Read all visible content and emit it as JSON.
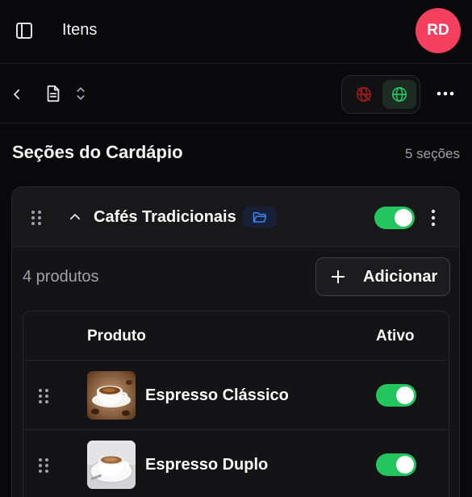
{
  "header": {
    "title": "Itens",
    "avatar_initials": "RD",
    "avatar_color": "#f43f5e"
  },
  "toolbar": {
    "icons": [
      "chevron-left-icon",
      "document-icon",
      "chevron-up-down-icon",
      "globe-off-icon",
      "globe-icon",
      "more-horizontal-icon"
    ]
  },
  "sections": {
    "heading": "Seções do Cardápio",
    "count_label": "5 seções"
  },
  "category": {
    "name": "Cafés Tradicionais",
    "enabled": true,
    "products_count_label": "4 produtos",
    "add_label": "Adicionar",
    "table": {
      "headers": {
        "product": "Produto",
        "active": "Ativo"
      },
      "rows": [
        {
          "name": "Espresso Clássico",
          "active": true
        },
        {
          "name": "Espresso Duplo",
          "active": true
        }
      ]
    }
  },
  "colors": {
    "accent_green": "#22c55e",
    "accent_blue": "#3b82f6",
    "disabled_red": "#7f1d1d",
    "background": "#09090b"
  }
}
